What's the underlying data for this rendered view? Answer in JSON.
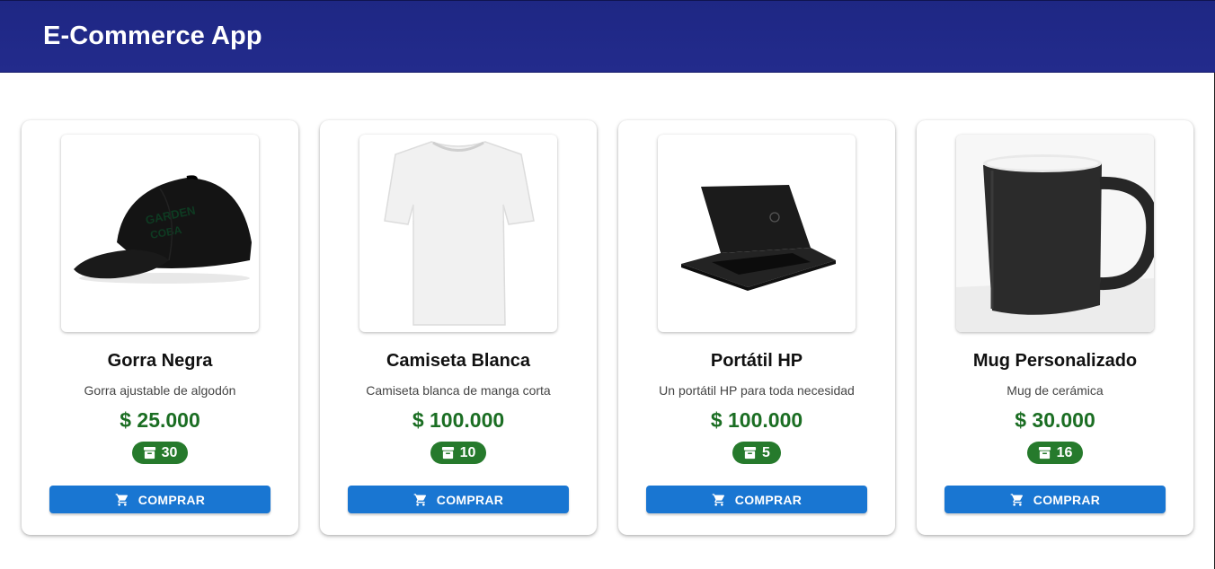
{
  "app": {
    "title": "E-Commerce App"
  },
  "products": [
    {
      "name": "Gorra Negra",
      "description": "Gorra ajustable de algodón",
      "price": "$ 25.000",
      "stock": "30",
      "button_label": "COMPRAR",
      "image_icon": "cap-image"
    },
    {
      "name": "Camiseta Blanca",
      "description": "Camiseta blanca de manga corta",
      "price": "$ 100.000",
      "stock": "10",
      "button_label": "COMPRAR",
      "image_icon": "tshirt-image"
    },
    {
      "name": "Portátil HP",
      "description": "Un portátil HP para toda necesidad",
      "price": "$ 100.000",
      "stock": "5",
      "button_label": "COMPRAR",
      "image_icon": "laptop-image"
    },
    {
      "name": "Mug Personalizado",
      "description": "Mug de cerámica",
      "price": "$ 30.000",
      "stock": "16",
      "button_label": "COMPRAR",
      "image_icon": "mug-image"
    }
  ],
  "colors": {
    "appbar": "#1e2784",
    "price": "#1b6e23",
    "stock_badge": "#267a2c",
    "button": "#1976d2"
  }
}
